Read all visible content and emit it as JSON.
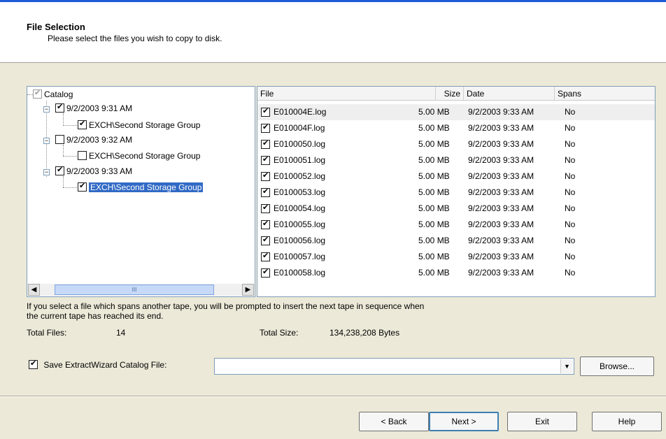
{
  "header": {
    "title": "File Selection",
    "subtitle": "Please select the files you wish to copy to disk."
  },
  "tree": {
    "root": {
      "label": "Catalog",
      "checked": true
    },
    "groups": [
      {
        "label": "9/2/2003 9:31 AM",
        "checked": true,
        "child": {
          "label": "EXCH\\Second Storage Group",
          "checked": true
        }
      },
      {
        "label": "9/2/2003 9:32 AM",
        "checked": false,
        "child": {
          "label": "EXCH\\Second Storage Group",
          "checked": false
        }
      },
      {
        "label": "9/2/2003 9:33 AM",
        "checked": true,
        "child": {
          "label": "EXCH\\Second Storage Group",
          "checked": true,
          "selected": true
        }
      }
    ],
    "scroll_left_icon": "chevron-left-icon",
    "scroll_right_icon": "chevron-right-icon",
    "thumb_grip": "III"
  },
  "file_list": {
    "columns": [
      "File",
      "Size",
      "Date",
      "Spans"
    ],
    "rows": [
      {
        "file": "E010004E.log",
        "size": "5.00 MB",
        "date": "9/2/2003 9:33 AM",
        "spans": "No"
      },
      {
        "file": "E010004F.log",
        "size": "5.00 MB",
        "date": "9/2/2003 9:33 AM",
        "spans": "No"
      },
      {
        "file": "E0100050.log",
        "size": "5.00 MB",
        "date": "9/2/2003 9:33 AM",
        "spans": "No"
      },
      {
        "file": "E0100051.log",
        "size": "5.00 MB",
        "date": "9/2/2003 9:33 AM",
        "spans": "No"
      },
      {
        "file": "E0100052.log",
        "size": "5.00 MB",
        "date": "9/2/2003 9:33 AM",
        "spans": "No"
      },
      {
        "file": "E0100053.log",
        "size": "5.00 MB",
        "date": "9/2/2003 9:33 AM",
        "spans": "No"
      },
      {
        "file": "E0100054.log",
        "size": "5.00 MB",
        "date": "9/2/2003 9:33 AM",
        "spans": "No"
      },
      {
        "file": "E0100055.log",
        "size": "5.00 MB",
        "date": "9/2/2003 9:33 AM",
        "spans": "No"
      },
      {
        "file": "E0100056.log",
        "size": "5.00 MB",
        "date": "9/2/2003 9:33 AM",
        "spans": "No"
      },
      {
        "file": "E0100057.log",
        "size": "5.00 MB",
        "date": "9/2/2003 9:33 AM",
        "spans": "No"
      },
      {
        "file": "E0100058.log",
        "size": "5.00 MB",
        "date": "9/2/2003 9:33 AM",
        "spans": "No"
      }
    ]
  },
  "note": {
    "line1": "If you select a file which spans another tape, you will be prompted to insert the next tape in sequence when",
    "line2": "the current tape has reached its end."
  },
  "totals": {
    "files_label": "Total Files:",
    "files_value": "14",
    "size_label": "Total Size:",
    "size_value": "134,238,208 Bytes"
  },
  "save_catalog": {
    "label": "Save ExtractWizard Catalog File:",
    "checked": true,
    "value": "",
    "browse_label": "Browse..."
  },
  "buttons": {
    "back": "< Back",
    "next": "Next >",
    "exit": "Exit",
    "help": "Help"
  },
  "colors": {
    "title_stripe": "#1c5ad8",
    "selection": "#316ac5",
    "dialog_bg": "#ece9d8"
  }
}
